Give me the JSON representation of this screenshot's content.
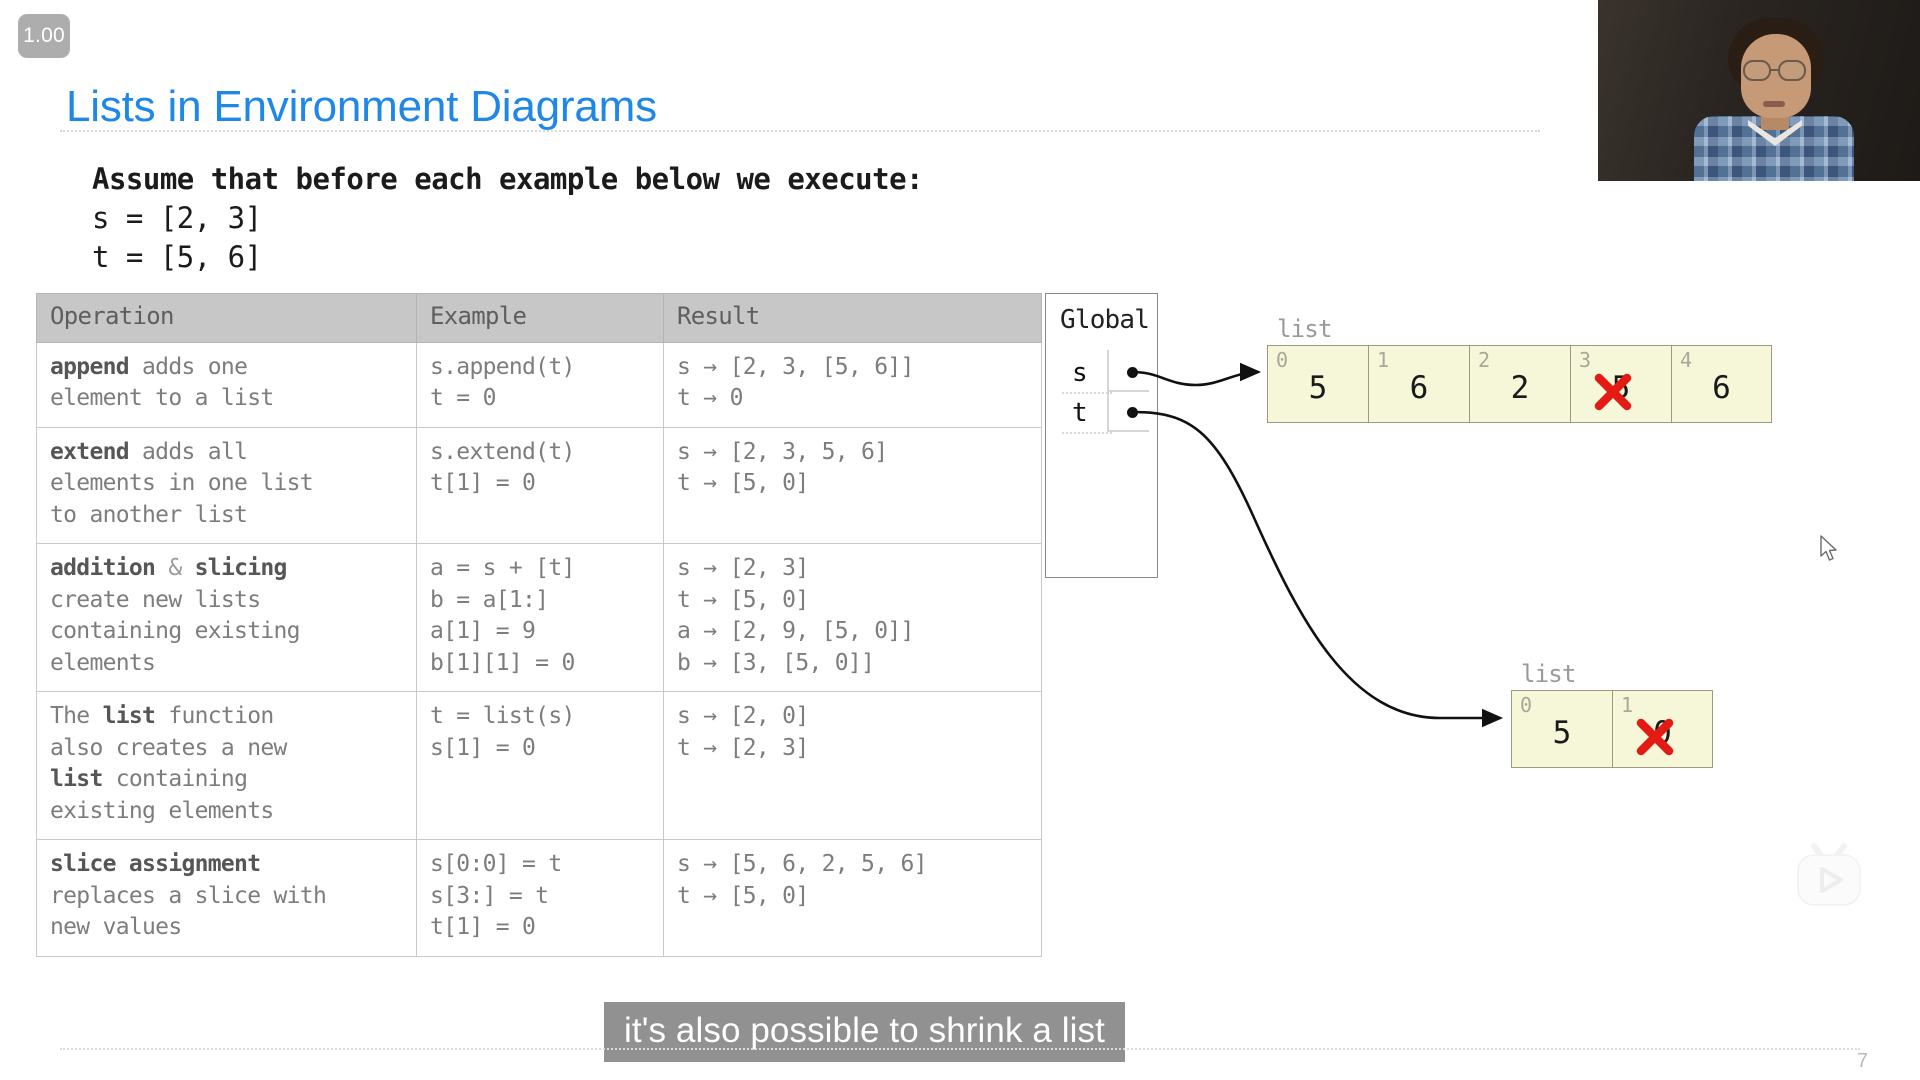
{
  "speed_badge": {
    "label": "1.00"
  },
  "slide": {
    "title": "Lists in Environment Diagrams",
    "assume": {
      "line1": "Assume that before each example below we execute:",
      "line2": "s = [2, 3]",
      "line3": "t = [5, 6]"
    },
    "page_number": "7"
  },
  "table": {
    "headers": [
      "Operation",
      "Example",
      "Result"
    ],
    "rows": [
      {
        "operation_bold": "append",
        "operation_rest": " adds one\nelement to a list",
        "operation_plain": "append adds one\nelement to a list",
        "example": "s.append(t)\nt = 0",
        "result": "s → [2, 3, [5, 6]]\nt → 0"
      },
      {
        "operation_bold": "extend",
        "operation_rest": " adds all\nelements in one list\nto another list",
        "operation_plain": "extend adds all\nelements in one list\nto another list",
        "example": "s.extend(t)\nt[1] = 0",
        "result": "s → [2, 3, 5, 6]\nt → [5, 0]"
      },
      {
        "operation_bold": "addition",
        "operation_bold2": "slicing",
        "operation_rest": "create new lists\ncontaining existing\nelements",
        "operation_plain": "addition & slicing\ncreate new lists\ncontaining existing\nelements",
        "example": "a = s + [t]\nb = a[1:]\na[1] = 9\nb[1][1] = 0",
        "result": "s → [2, 3]\nt → [5, 0]\na → [2, 9, [5, 0]]\nb → [3, [5, 0]]"
      },
      {
        "operation_bold": "list",
        "operation_rest": "The list function\nalso creates a new\nlist containing\nexisting elements",
        "operation_plain": "The list function\nalso creates a new\nlist containing\nexisting elements",
        "example": "t = list(s)\ns[1] = 0",
        "result": "s → [2, 0]\nt → [2, 3]"
      },
      {
        "operation_bold": "slice assignment",
        "operation_rest": "replaces a slice with\nnew values",
        "operation_plain": "slice assignment\nreplaces a slice with\nnew values",
        "example": "s[0:0] = t\ns[3:] = t\nt[1] = 0",
        "result": "s → [5, 6, 2, 5, 6]\nt → [5, 0]"
      }
    ]
  },
  "environment": {
    "frame_title": "Global",
    "bindings": [
      {
        "name": "s"
      },
      {
        "name": "t"
      }
    ]
  },
  "lists": [
    {
      "label": "list",
      "cells": [
        {
          "index": "0",
          "value": "5",
          "struck": false
        },
        {
          "index": "1",
          "value": "6",
          "struck": false
        },
        {
          "index": "2",
          "value": "2",
          "struck": false
        },
        {
          "index": "3",
          "value": "5",
          "struck": true
        },
        {
          "index": "4",
          "value": "6",
          "struck": false
        }
      ]
    },
    {
      "label": "list",
      "cells": [
        {
          "index": "0",
          "value": "5",
          "struck": false
        },
        {
          "index": "1",
          "value": "0",
          "struck": true
        }
      ]
    }
  ],
  "caption": {
    "text": "it's also possible to shrink a list"
  },
  "colors": {
    "title_blue": "#1f87e8",
    "header_gray": "#c7c7c7",
    "list_fill": "#f6f6d9",
    "cross_red": "#e31b15",
    "caption_bg": "#828282"
  },
  "icons": {
    "watermark": "tv-play-icon",
    "cursor": "mouse-pointer-icon"
  }
}
